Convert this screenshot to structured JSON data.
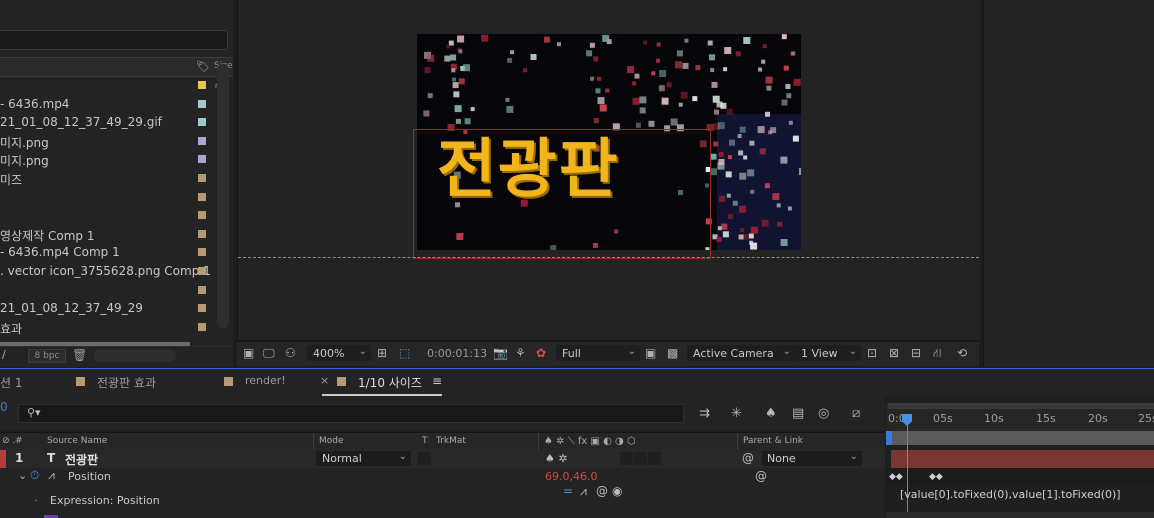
{
  "project": {
    "header_size": "Size",
    "items": [
      {
        "name": "",
        "color": "#e6c84c"
      },
      {
        "name": "- 6436.mp4",
        "color": "#9fc9c9"
      },
      {
        "name": "21_01_08_12_37_49_29.gif",
        "color": "#9fc9c9"
      },
      {
        "name": "미지.png",
        "color": "#a8a8d0"
      },
      {
        "name": "미지.png",
        "color": "#a8a8d0"
      },
      {
        "name": "미즈",
        "color": "#b59a76"
      },
      {
        "name": "",
        "color": "#b59a76"
      },
      {
        "name": "",
        "color": "#b59a76"
      },
      {
        "name": "영상제작 Comp 1",
        "color": "#b59a76"
      },
      {
        "name": "- 6436.mp4 Comp 1",
        "color": "#b59a76"
      },
      {
        "name": ". vector icon_3755628.png Comp 1",
        "color": "#b59a76"
      },
      {
        "name": "",
        "color": "#b59a76"
      },
      {
        "name": "21_01_08_12_37_49_29",
        "color": "#b59a76"
      },
      {
        "name": "효과",
        "color": "#b59a76"
      }
    ],
    "bpc": "8 bpc"
  },
  "viewer": {
    "comp_text": "전광판",
    "zoom": "400%",
    "timecode": "0:00:01:13",
    "resolution": "Full",
    "camera": "Active Camera",
    "view_layout": "1 View"
  },
  "tabs": [
    {
      "label": "션 1",
      "color": ""
    },
    {
      "label": "전광판 효과",
      "color": "#b59a76"
    },
    {
      "label": "render!",
      "color": "#b59a76"
    },
    {
      "label": "1/10 사이즈",
      "color": "#b59a76",
      "active": true
    }
  ],
  "timeline": {
    "columns": {
      "num": "#",
      "source_name": "Source Name",
      "mode": "Mode",
      "t": "T",
      "trkmat": "TrkMat",
      "parent": "Parent & Link"
    },
    "ruler_ticks": [
      "0:00",
      "05s",
      "10s",
      "15s",
      "20s",
      "25s"
    ],
    "layer": {
      "number": "1",
      "type_icon": "T",
      "name": "전광판",
      "mode": "Normal",
      "parent": "None",
      "label_color": "#b63c3c"
    },
    "property": {
      "name": "Position",
      "value": "69.0,46.0"
    },
    "expression": {
      "label": "Expression: Position",
      "code": "[value[0].toFixed(0),value[1].toFixed(0)]"
    }
  }
}
